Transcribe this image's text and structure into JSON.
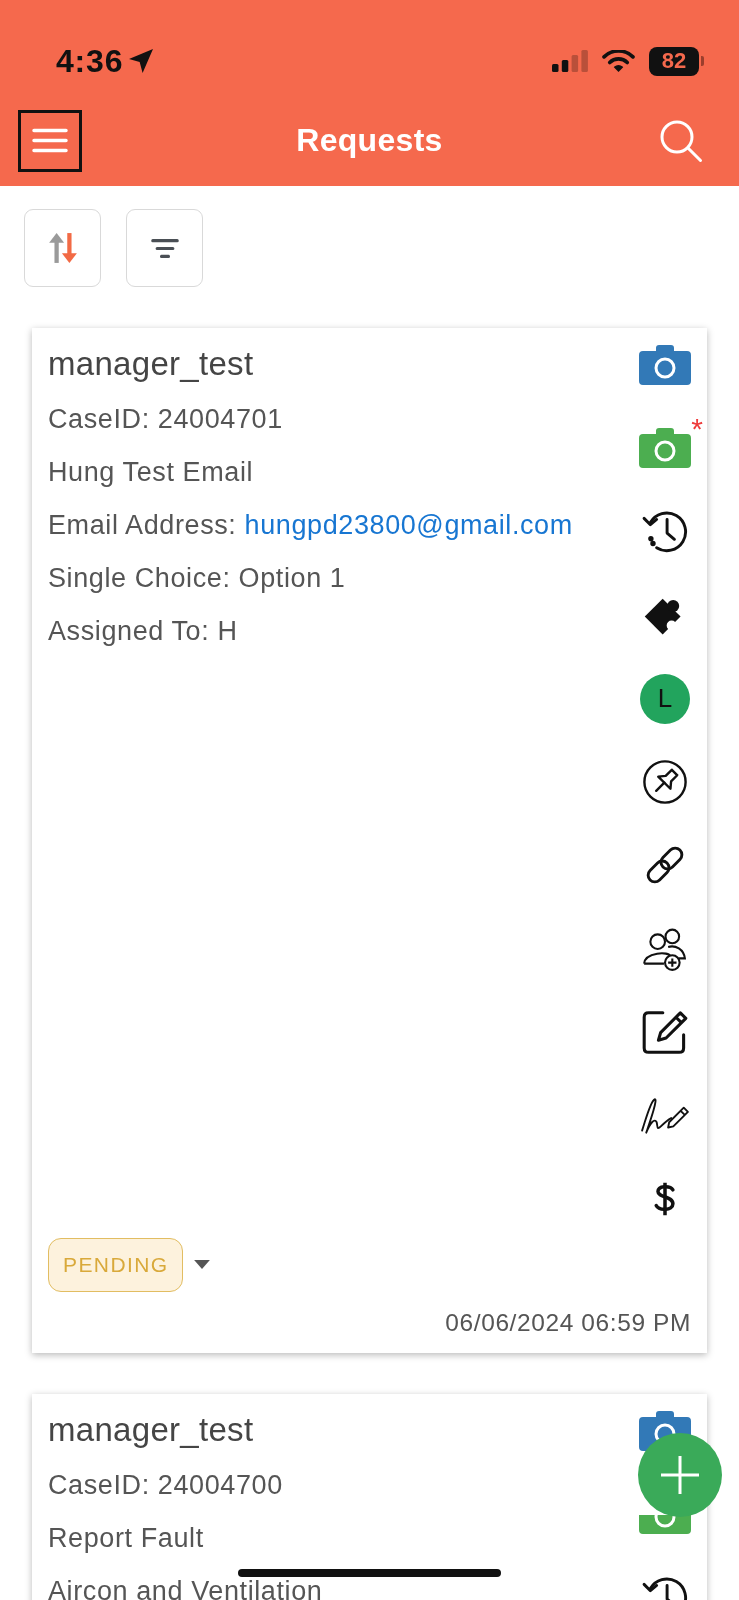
{
  "status_bar": {
    "time": "4:36",
    "battery": "82"
  },
  "header": {
    "title": "Requests",
    "menu_button": {
      "focused": true
    }
  },
  "requests": [
    {
      "title": "manager_test",
      "truncated": false,
      "fields": [
        {
          "kind": "text",
          "text": "CaseID: 24004701"
        },
        {
          "kind": "text",
          "text": "Hung Test Email"
        },
        {
          "kind": "link",
          "label": "Email Address:",
          "value": "hungpd23800@gmail.com"
        },
        {
          "kind": "text",
          "text": "Single Choice: Option 1"
        },
        {
          "kind": "text",
          "text": "Assigned To: H"
        }
      ],
      "required_mark": "*",
      "assignee_initial": "L",
      "status": "PENDING",
      "date": "06/06/2024 06:59 PM"
    },
    {
      "title": "manager_test",
      "truncated": true,
      "fields": [
        {
          "kind": "text",
          "text": "CaseID: 24004700"
        },
        {
          "kind": "text",
          "text": "Report Fault"
        },
        {
          "kind": "text",
          "text": "Aircon and Ventilation"
        }
      ]
    }
  ]
}
